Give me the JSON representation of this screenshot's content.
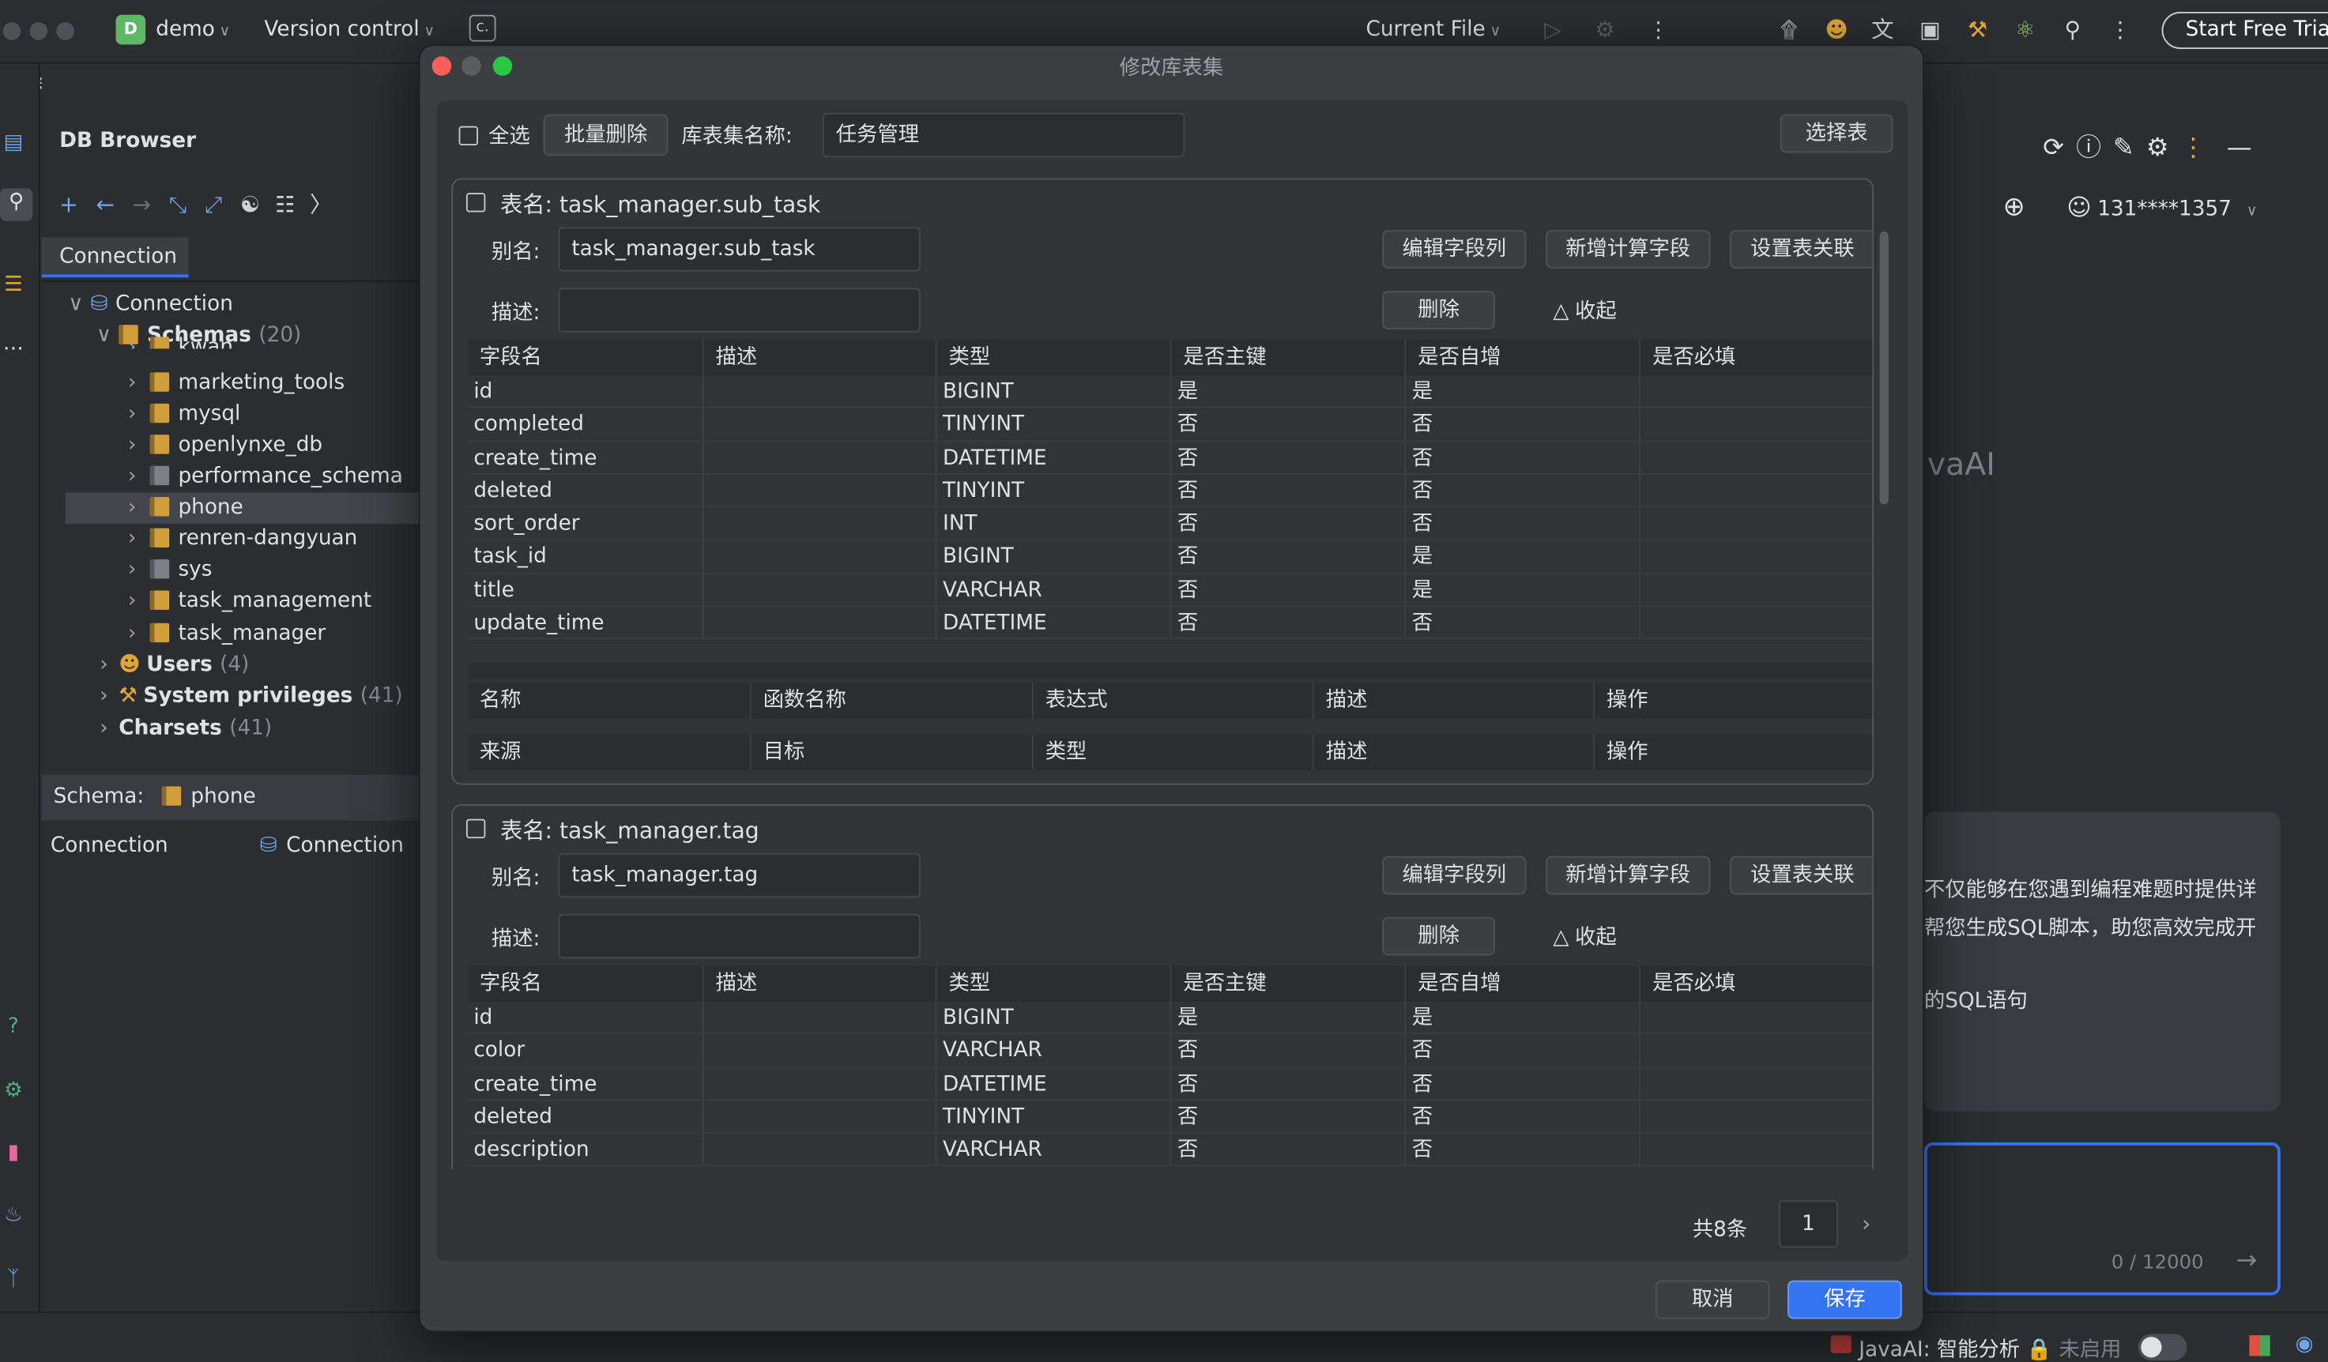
{
  "topbar": {
    "project_badge": "D",
    "project_name": "demo",
    "version_control": "Version control",
    "current_file": "Current File",
    "start_trial": "Start Free Trial",
    "icons": [
      "run-icon",
      "debug-icon",
      "more-icon",
      "spiral-icon",
      "users-icon",
      "translate-icon",
      "code-icon",
      "tools-icon",
      "atom-icon",
      "search-icon",
      "kebab-icon"
    ]
  },
  "breadcrumb": "demo",
  "db_browser": {
    "title": "DB Browser",
    "tab": "Connection",
    "tree": [
      {
        "label": "Connection",
        "level": 0,
        "expanded": true,
        "type": "db"
      },
      {
        "label": "Schemas",
        "count": "(20)",
        "level": 1,
        "expanded": true,
        "type": "schemas"
      },
      {
        "label": "kwan",
        "level": 2,
        "type": "folder",
        "partial": true
      },
      {
        "label": "marketing_tools",
        "level": 2,
        "type": "folder"
      },
      {
        "label": "mysql",
        "level": 2,
        "type": "folder"
      },
      {
        "label": "openlynxe_db",
        "level": 2,
        "type": "folder"
      },
      {
        "label": "performance_schema",
        "level": 2,
        "type": "folder-grey"
      },
      {
        "label": "phone",
        "level": 2,
        "type": "folder",
        "selected": true
      },
      {
        "label": "renren-dangyuan",
        "level": 2,
        "type": "folder"
      },
      {
        "label": "sys",
        "level": 2,
        "type": "folder-grey"
      },
      {
        "label": "task_management",
        "level": 2,
        "type": "folder"
      },
      {
        "label": "task_manager",
        "level": 2,
        "type": "folder"
      },
      {
        "label": "Users",
        "count": "(4)",
        "level": 1,
        "type": "users"
      },
      {
        "label": "System privileges",
        "count": "(41)",
        "level": 1,
        "type": "privileges"
      },
      {
        "label": "Charsets",
        "count": "(41)",
        "level": 1,
        "type": "none"
      }
    ],
    "schema_label": "Schema:",
    "schema_value": "phone",
    "prop_key": "Connection",
    "prop_value": "Connection"
  },
  "right_panel": {
    "user": "131****1357",
    "brand_fragment": "vaAI",
    "text_line1": "不仅能够在您遇到编程难题时提供详",
    "text_line2": "帮您生成SQL脚本，助您高效完成开",
    "text_line3": "的SQL语句",
    "counter": "0 / 12000"
  },
  "statusbar": {
    "javaai_label": "JavaAI:",
    "analysis": "智能分析",
    "disabled": "未启用"
  },
  "dialog": {
    "title": "修改库表集",
    "select_all": "全选",
    "batch_delete": "批量删除",
    "set_name_label": "库表集名称:",
    "set_name_value": "任务管理",
    "choose_table": "选择表",
    "field_headers": [
      "字段名",
      "描述",
      "类型",
      "是否主键",
      "是否自增",
      "是否必填"
    ],
    "calc_headers": [
      "名称",
      "函数名称",
      "表达式",
      "描述",
      "操作"
    ],
    "rel_headers": [
      "来源",
      "目标",
      "类型",
      "描述",
      "操作"
    ],
    "alias_label": "别名:",
    "desc_label": "描述:",
    "edit_columns": "编辑字段列",
    "add_calc": "新增计算字段",
    "set_relation": "设置表关联",
    "delete": "删除",
    "collapse": "收起",
    "tables": [
      {
        "title": "表名: task_manager.sub_task",
        "alias": "task_manager.sub_task",
        "rows": [
          [
            "id",
            "",
            "BIGINT",
            "是",
            "是",
            ""
          ],
          [
            "completed",
            "",
            "TINYINT",
            "否",
            "否",
            ""
          ],
          [
            "create_time",
            "",
            "DATETIME",
            "否",
            "否",
            ""
          ],
          [
            "deleted",
            "",
            "TINYINT",
            "否",
            "否",
            ""
          ],
          [
            "sort_order",
            "",
            "INT",
            "否",
            "否",
            ""
          ],
          [
            "task_id",
            "",
            "BIGINT",
            "否",
            "是",
            ""
          ],
          [
            "title",
            "",
            "VARCHAR",
            "否",
            "是",
            ""
          ],
          [
            "update_time",
            "",
            "DATETIME",
            "否",
            "否",
            ""
          ]
        ]
      },
      {
        "title": "表名: task_manager.tag",
        "alias": "task_manager.tag",
        "rows": [
          [
            "id",
            "",
            "BIGINT",
            "是",
            "是",
            ""
          ],
          [
            "color",
            "",
            "VARCHAR",
            "否",
            "否",
            ""
          ],
          [
            "create_time",
            "",
            "DATETIME",
            "否",
            "否",
            ""
          ],
          [
            "deleted",
            "",
            "TINYINT",
            "否",
            "否",
            ""
          ],
          [
            "description",
            "",
            "VARCHAR",
            "否",
            "否",
            ""
          ]
        ]
      }
    ],
    "pagination_total": "共8条",
    "page_number": "1",
    "cancel": "取消",
    "save": "保存"
  }
}
